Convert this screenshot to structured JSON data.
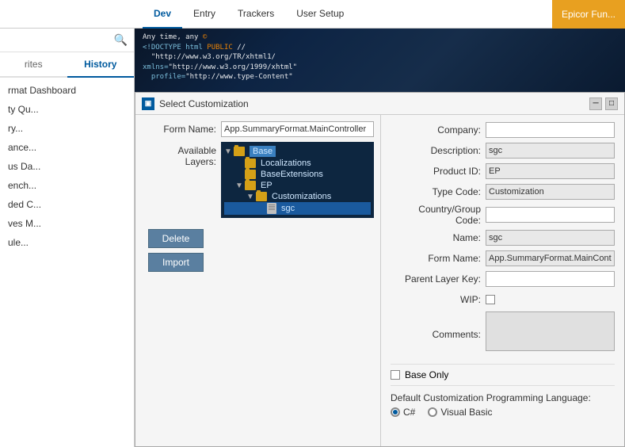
{
  "topNav": {
    "tabs": [
      {
        "label": "Dev",
        "active": true
      },
      {
        "label": "Entry",
        "active": false
      },
      {
        "label": "Trackers",
        "active": false
      },
      {
        "label": "User Setup",
        "active": false
      }
    ],
    "epicorLabel": "Epicor Fun..."
  },
  "sidebar": {
    "searchIcon": "🔍",
    "tabs": [
      {
        "label": "rites",
        "active": false
      },
      {
        "label": "History",
        "active": true
      }
    ],
    "items": [
      {
        "label": "rmat Dashboard",
        "type": "item"
      },
      {
        "label": "ty Qu...",
        "type": "item"
      },
      {
        "label": "ry...",
        "type": "item"
      },
      {
        "label": "ance...",
        "type": "item"
      },
      {
        "label": "us Da...",
        "type": "item"
      },
      {
        "label": "ench...",
        "type": "item"
      },
      {
        "label": "ded C...",
        "type": "item"
      },
      {
        "label": "ves M...",
        "type": "item"
      },
      {
        "label": "ule...",
        "type": "item"
      }
    ]
  },
  "dialog": {
    "title": "Select Customization",
    "formName": "App.SummaryFormat.MainController",
    "availableLayers": "Available Layers:",
    "tree": {
      "nodes": [
        {
          "label": "Base",
          "type": "folder",
          "level": 0,
          "expanded": true,
          "selected": false,
          "hasToggle": true
        },
        {
          "label": "Localizations",
          "type": "folder",
          "level": 1,
          "expanded": false,
          "selected": false,
          "hasToggle": false
        },
        {
          "label": "BaseExtensions",
          "type": "folder",
          "level": 1,
          "expanded": false,
          "selected": false,
          "hasToggle": false
        },
        {
          "label": "EP",
          "type": "folder",
          "level": 1,
          "expanded": true,
          "selected": false,
          "hasToggle": true
        },
        {
          "label": "Customizations",
          "type": "folder",
          "level": 2,
          "expanded": true,
          "selected": false,
          "hasToggle": true
        },
        {
          "label": "sgc",
          "type": "file",
          "level": 3,
          "expanded": false,
          "selected": true,
          "hasToggle": false
        }
      ]
    },
    "buttons": [
      {
        "label": "Delete"
      },
      {
        "label": "Import"
      }
    ]
  },
  "rightPanel": {
    "fields": [
      {
        "label": "Company:",
        "value": "",
        "filled": false
      },
      {
        "label": "Description:",
        "value": "sgc",
        "filled": true
      },
      {
        "label": "Product ID:",
        "value": "EP",
        "filled": true
      },
      {
        "label": "Type Code:",
        "value": "Customization",
        "filled": true
      },
      {
        "label": "Country/Group Code:",
        "value": "",
        "filled": false
      },
      {
        "label": "Name:",
        "value": "sgc",
        "filled": true
      },
      {
        "label": "Form Name:",
        "value": "App.SummaryFormat.MainControll...",
        "filled": true
      },
      {
        "label": "Parent Layer Key:",
        "value": "",
        "filled": false
      }
    ],
    "wip": {
      "label": "WIP:",
      "checked": false
    },
    "comments": {
      "label": "Comments:"
    },
    "baseOnly": {
      "label": "Base Only",
      "checked": false
    },
    "langSection": {
      "label": "Default Customization Programming Language:",
      "options": [
        {
          "label": "C#",
          "selected": true
        },
        {
          "label": "Visual Basic",
          "selected": false
        }
      ]
    }
  },
  "headerCode": "Any time, any ©\r\n<!DOCTYPE html PUBLIC //\r\n  \"http://www.w3.org/TR/xhtml1/\r\nxmlns=\"http://www.w3.org/1999/xhtml\"\r\n  profile=\"http://www.type-Content\""
}
